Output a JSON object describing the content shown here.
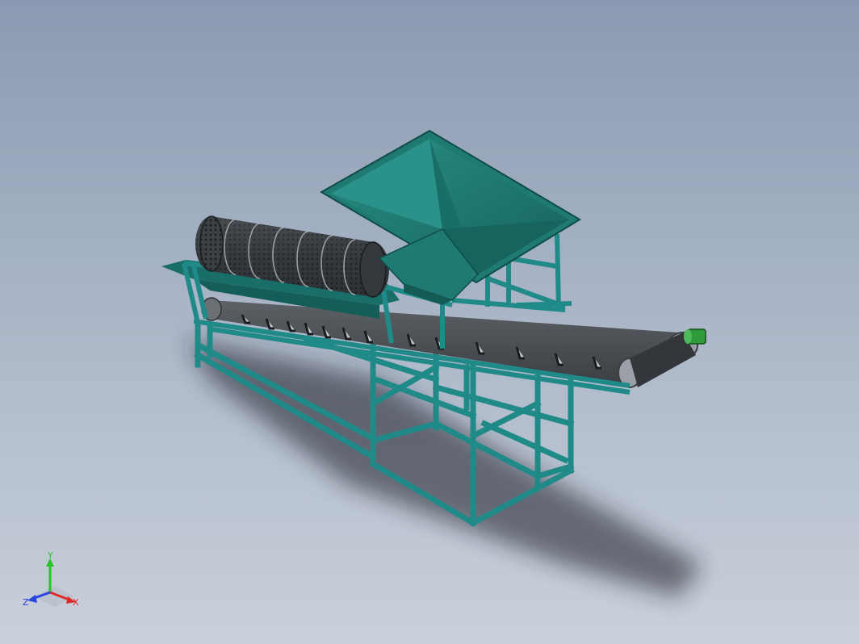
{
  "viewport": {
    "background_top": "#8a9ab2",
    "background_bottom": "#c9d0da"
  },
  "model": {
    "frame_color": "#1f8a88",
    "hopper_color": "#1e7a72",
    "belt_color": "#4a4f53",
    "drum_color": "#3a3f44",
    "motor_color": "#2f9a3a"
  },
  "triad": {
    "y_label": "Y",
    "x_label": "X",
    "z_label": "Z",
    "y_color": "#22c522",
    "x_color": "#e02a2a",
    "z_color": "#2a44e0"
  }
}
